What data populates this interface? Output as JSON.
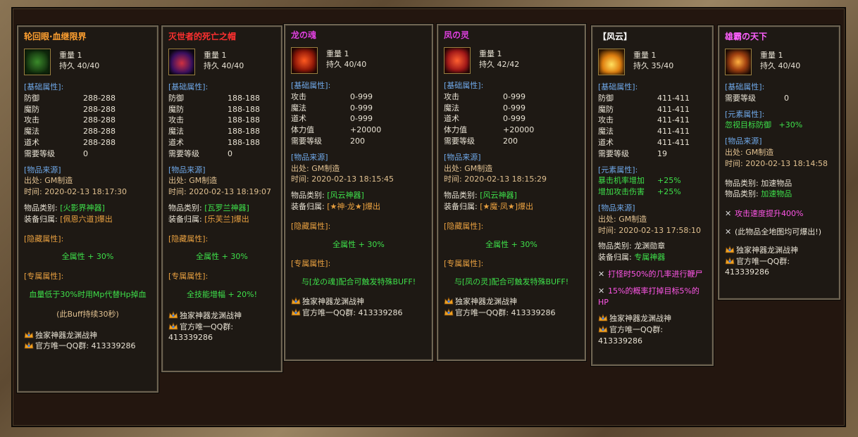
{
  "tooltips": [
    {
      "title": "轮回眼·血继限界",
      "title_color": "#ffa030",
      "weight": "重量 1",
      "durability": "持久 40/40",
      "base_header": "[基础属性]:",
      "base": [
        [
          "防御",
          "288-288"
        ],
        [
          "魔防",
          "288-288"
        ],
        [
          "攻击",
          "288-288"
        ],
        [
          "魔法",
          "288-288"
        ],
        [
          "道术",
          "288-288"
        ],
        [
          "需要等级",
          "0"
        ]
      ],
      "source_header": "[物品来源]",
      "origin": "出处: GM制造",
      "time": "时间: 2020-02-13 18:17:30",
      "cat_label": "物品类别:",
      "cat_value": "[火影界神器]",
      "owner_label": "装备归属:",
      "owner_value": "[佩恩六道]爆出",
      "hidden_header": "[隐藏属性]:",
      "hidden_value": "全属性 + 30%",
      "special_header": "[专属属性]:",
      "special_value": "血量低于30%时用Mp代替Hp掉血",
      "extra": "(此Buff持续30秒)",
      "footer1": "独家神器龙渊战神",
      "footer2": "官方唯一QQ群: 413339286"
    },
    {
      "title": "灭世者的死亡之帽",
      "title_color": "#ff3030",
      "weight": "重量 1",
      "durability": "持久 40/40",
      "base_header": "[基础属性]:",
      "base": [
        [
          "防御",
          "188-188"
        ],
        [
          "魔防",
          "188-188"
        ],
        [
          "攻击",
          "188-188"
        ],
        [
          "魔法",
          "188-188"
        ],
        [
          "道术",
          "188-188"
        ],
        [
          "需要等级",
          "0"
        ]
      ],
      "source_header": "[物品来源]",
      "origin": "出处: GM制造",
      "time": "时间: 2020-02-13 18:19:07",
      "cat_label": "物品类别:",
      "cat_value": "[瓦罗兰神器]",
      "owner_label": "装备归属:",
      "owner_value": "[乐芙兰]爆出",
      "hidden_header": "[隐藏属性]:",
      "hidden_value": "全属性 + 30%",
      "special_header": "[专属属性]:",
      "special_value": "全技能增幅 + 20%!",
      "footer1": "独家神器龙渊战神",
      "footer2": "官方唯一QQ群: 413339286"
    },
    {
      "title": "龙の魂",
      "title_color": "#e040e0",
      "weight": "重量 1",
      "durability": "持久 40/40",
      "base_header": "[基础属性]:",
      "base": [
        [
          "攻击",
          "0-999"
        ],
        [
          "魔法",
          "0-999"
        ],
        [
          "道术",
          "0-999"
        ],
        [
          "体力值",
          "+20000"
        ],
        [
          "需要等级",
          "200"
        ]
      ],
      "source_header": "[物品来源]",
      "origin": "出处: GM制造",
      "time": "时间: 2020-02-13 18:15:45",
      "cat_label": "物品类别:",
      "cat_value": "[风云神器]",
      "owner_label": "装备归属:",
      "owner_value": "[★神·龙★]爆出",
      "hidden_header": "[隐藏属性]:",
      "hidden_value": "全属性 + 30%",
      "special_header": "[专属属性]:",
      "special_value": "与[龙の魂]配合可触发特殊BUFF!",
      "footer1": "独家神器龙渊战神",
      "footer2": "官方唯一QQ群: 413339286"
    },
    {
      "title": "凤の灵",
      "title_color": "#e040e0",
      "weight": "重量 1",
      "durability": "持久 42/42",
      "base_header": "[基础属性]:",
      "base": [
        [
          "攻击",
          "0-999"
        ],
        [
          "魔法",
          "0-999"
        ],
        [
          "道术",
          "0-999"
        ],
        [
          "体力值",
          "+20000"
        ],
        [
          "需要等级",
          "200"
        ]
      ],
      "source_header": "[物品来源]",
      "origin": "出处: GM制造",
      "time": "时间: 2020-02-13 18:15:29",
      "cat_label": "物品类别:",
      "cat_value": "[风云神器]",
      "owner_label": "装备归属:",
      "owner_value": "[★魔·凤★]爆出",
      "hidden_header": "[隐藏属性]:",
      "hidden_value": "全属性 + 30%",
      "special_header": "[专属属性]:",
      "special_value": "与[凤の灵]配合可触发特殊BUFF!",
      "footer1": "独家神器龙渊战神",
      "footer2": "官方唯一QQ群: 413339286"
    },
    {
      "title": "【风云】",
      "title_color": "#ffffff",
      "weight": "重量 1",
      "durability": "持久 35/40",
      "base_header": "[基础属性]:",
      "base": [
        [
          "防御",
          "411-411"
        ],
        [
          "魔防",
          "411-411"
        ],
        [
          "攻击",
          "411-411"
        ],
        [
          "魔法",
          "411-411"
        ],
        [
          "道术",
          "411-411"
        ],
        [
          "需要等级",
          "19"
        ]
      ],
      "element_header": "[元素属性]:",
      "element": [
        [
          "暴击机率增加",
          "+25%"
        ],
        [
          "增加攻击伤害",
          "+25%"
        ]
      ],
      "source_header": "[物品来源]",
      "origin": "出处: GM制造",
      "time": "时间: 2020-02-13 17:58:10",
      "cat_label": "物品类别:",
      "cat_value": "龙渊勋章",
      "owner_label": "装备归属:",
      "owner_value": "专属神器",
      "perk1": "打怪时50%的几率进行鞭尸",
      "perk2": "15%的概率打掉目标5%的HP",
      "footer1": "独家神器龙渊战神",
      "footer2": "官方唯一QQ群: 413339286"
    },
    {
      "title": "雄霸の天下",
      "title_color": "#ff60ff",
      "weight": "重量 1",
      "durability": "持久 40/40",
      "base_header": "[基础属性]:",
      "base": [
        [
          "需要等级",
          "0"
        ]
      ],
      "element_header": "[元素属性]:",
      "element_text": "忽视目标防御",
      "element_value": "+30%",
      "source_header": "[物品来源]",
      "origin": "出处: GM制造",
      "time": "时间: 2020-02-13 18:14:58",
      "cat_label": "物品类别:",
      "cat_value": "加速物品",
      "owner_label": "物品类别:",
      "owner_value": "加速物品",
      "perk1": "攻击速度提升400%",
      "perk2": "(此物品全地图均可爆出!)",
      "footer1": "独家神器龙渊战神",
      "footer2": "官方唯一QQ群: 413339286"
    }
  ]
}
